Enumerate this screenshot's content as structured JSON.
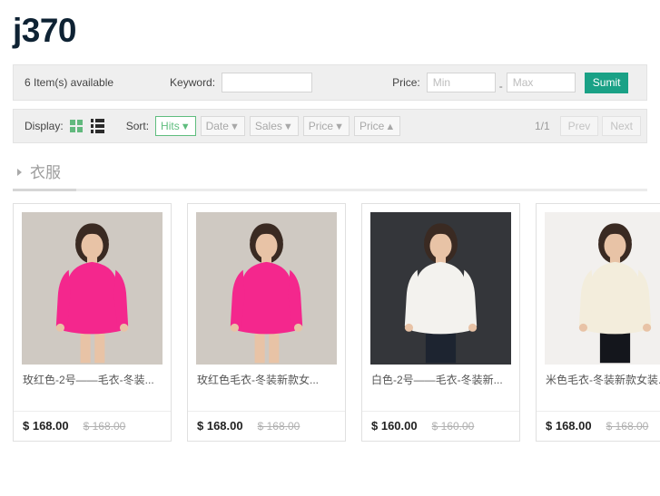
{
  "header": {
    "title": "j370"
  },
  "filter_bar": {
    "items_available": "6 Item(s) available",
    "keyword_label": "Keyword:",
    "keyword_value": "",
    "keyword_placeholder": "",
    "price_label": "Price:",
    "price_min_value": "",
    "price_min_placeholder": "Min",
    "price_separator": "-",
    "price_max_value": "",
    "price_max_placeholder": "Max",
    "submit_label": "Sumit"
  },
  "sort_bar": {
    "display_label": "Display:",
    "grid_icon": "grid-view-icon",
    "list_icon": "list-view-icon",
    "sort_label": "Sort:",
    "options": [
      {
        "label": "Hits",
        "caret": "▼",
        "active": true
      },
      {
        "label": "Date",
        "caret": "▼",
        "active": false
      },
      {
        "label": "Sales",
        "caret": "▼",
        "active": false
      },
      {
        "label": "Price",
        "caret": "▼",
        "active": false
      },
      {
        "label": "Price",
        "caret": "▲",
        "active": false
      }
    ],
    "page_indicator": "1/1",
    "prev_label": "Prev",
    "next_label": "Next"
  },
  "category": {
    "name": "衣服"
  },
  "products": [
    {
      "title": "玫红色-2号——毛衣-冬装...",
      "price": "$ 168.00",
      "old_price": "$ 168.00",
      "image_alt": "pink-sweater-dress-model",
      "bg": "#cfc9c2",
      "garment": "#f4278d",
      "pants": "none"
    },
    {
      "title": "玫红色毛衣-冬装新款女...",
      "price": "$ 168.00",
      "old_price": "$ 168.00",
      "image_alt": "pink-sweater-dress-model",
      "bg": "#cfc9c2",
      "garment": "#f4278d",
      "pants": "none"
    },
    {
      "title": "白色-2号——毛衣-冬装新...",
      "price": "$ 160.00",
      "old_price": "$ 160.00",
      "image_alt": "white-turtleneck-model-dark-background",
      "bg": "#34363a",
      "garment": "#f3f2ee",
      "pants": "#1d2430"
    },
    {
      "title": "米色毛衣-冬装新款女装...",
      "price": "$ 168.00",
      "old_price": "$ 168.00",
      "image_alt": "cream-turtleneck-black-jeans-model",
      "bg": "#f2f0ee",
      "garment": "#f3eddc",
      "pants": "#14161c"
    }
  ],
  "colors": {
    "accent_teal": "#1aa186",
    "accent_green": "#62b97e",
    "title_navy": "#0e2233"
  }
}
